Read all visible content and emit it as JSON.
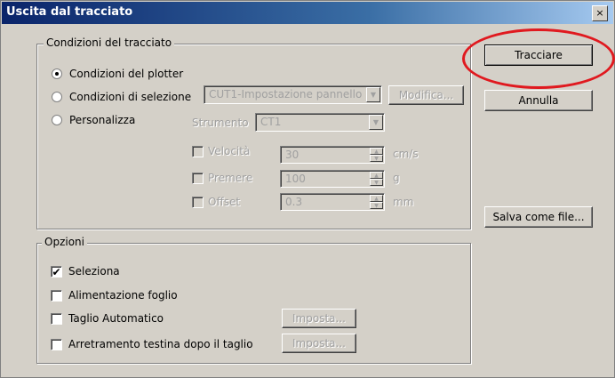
{
  "window": {
    "title": "Uscita dal tracciato",
    "close_label": "×"
  },
  "conditions_group": {
    "legend": "Condizioni del tracciato",
    "radio_plotter": "Condizioni del plotter",
    "radio_selection": "Condizioni di selezione",
    "radio_custom": "Personalizza",
    "selected": "plotter",
    "selection_dropdown_value": "CUT1-Impostazione pannello",
    "modify_button": "Modifica...",
    "tool_label": "Strumento",
    "tool_value": "CT1",
    "velocity_label": "Velocità",
    "velocity_value": "30",
    "velocity_unit": "cm/s",
    "pressure_label": "Premere",
    "pressure_value": "100",
    "pressure_unit": "g",
    "offset_label": "Offset",
    "offset_value": "0.3",
    "offset_unit": "mm"
  },
  "options_group": {
    "legend": "Opzioni",
    "select_label": "Seleziona",
    "select_checked": true,
    "feed_label": "Alimentazione foglio",
    "autocut_label": "Taglio Automatico",
    "autocut_setup_button": "Imposta...",
    "retract_label": "Arretramento testina dopo il taglio",
    "retract_setup_button": "Imposta..."
  },
  "buttons": {
    "trace": "Tracciare",
    "cancel": "Annulla",
    "save_as_file": "Salva come file..."
  },
  "colors": {
    "highlight": "#e0191f",
    "title_bar": "#0a246a",
    "dialog_bg": "#d4d0c8"
  }
}
